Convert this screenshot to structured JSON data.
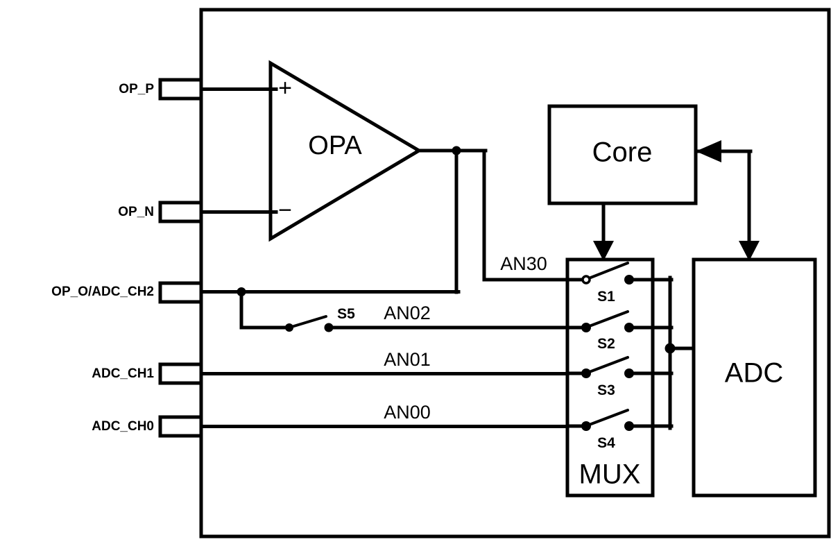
{
  "diagram": {
    "title": "OPA MUX ADC block diagram",
    "line_color": "#000000",
    "background_color": "#ffffff"
  },
  "chip": {
    "label": ""
  },
  "pins": [
    {
      "id": "op-p",
      "label": "OP_P"
    },
    {
      "id": "op-n",
      "label": "OP_N"
    },
    {
      "id": "op-o",
      "label": "OP_O/ADC_CH2"
    },
    {
      "id": "adc-ch1",
      "label": "ADC_CH1"
    },
    {
      "id": "adc-ch0",
      "label": "ADC_CH0"
    }
  ],
  "opa": {
    "label": "OPA",
    "plus": "+",
    "minus": "−"
  },
  "blocks": {
    "core": {
      "label": "Core"
    },
    "mux": {
      "label": "MUX"
    },
    "adc": {
      "label": "ADC"
    }
  },
  "nets": [
    {
      "id": "an30",
      "label": "AN30"
    },
    {
      "id": "an02",
      "label": "AN02"
    },
    {
      "id": "an01",
      "label": "AN01"
    },
    {
      "id": "an00",
      "label": "AN00"
    }
  ],
  "switches": [
    {
      "id": "s1",
      "label": "S1",
      "state": "open"
    },
    {
      "id": "s2",
      "label": "S2",
      "state": "open"
    },
    {
      "id": "s3",
      "label": "S3",
      "state": "open"
    },
    {
      "id": "s4",
      "label": "S4",
      "state": "open"
    },
    {
      "id": "s5",
      "label": "S5",
      "state": "open"
    }
  ]
}
